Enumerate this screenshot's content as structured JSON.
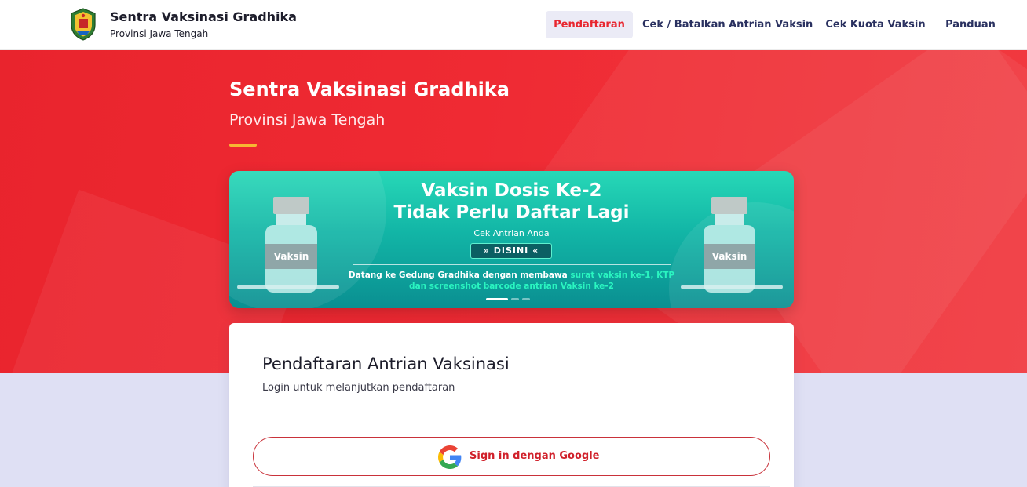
{
  "header": {
    "brand_title": "Sentra Vaksinasi Gradhika",
    "brand_subtitle": "Provinsi Jawa Tengah",
    "logo_icon": "province-crest-icon",
    "nav": [
      {
        "label": "Pendaftaran",
        "active": true
      },
      {
        "label": "Cek / Batalkan Antrian Vaksin",
        "active": false
      },
      {
        "label": "Cek Kuota Vaksin",
        "active": false
      },
      {
        "label": "Panduan",
        "active": false
      }
    ]
  },
  "hero": {
    "title": "Sentra Vaksinasi Gradhika",
    "subtitle": "Provinsi Jawa Tengah"
  },
  "banner": {
    "title_line1": "Vaksin Dosis Ke-2",
    "title_line2": "Tidak Perlu Daftar Lagi",
    "small_text": "Cek Antrian Anda",
    "button_label": "DISINI",
    "vial_label": "Vaksin",
    "info_line1_plain": "Datang ke Gedung Gradhika dengan membawa ",
    "info_line1_highlight": "surat vaksin ke-1, KTP",
    "info_line2_highlight": "dan screenshot barcode antrian Vaksin ke-2",
    "slide_count": 3,
    "active_slide": 1
  },
  "card": {
    "title": "Pendaftaran Antrian Vaksinasi",
    "subtitle": "Login untuk melanjutkan pendaftaran",
    "google_button_label": "Sign in dengan Google",
    "google_icon": "google-g-icon"
  },
  "colors": {
    "brand_red": "#e9242d",
    "accent_yellow": "#f7b733",
    "banner_teal": "#12b5a6",
    "highlight_green": "#2af5c0",
    "nav_text": "#2a3160",
    "page_bg": "#dfe0f4"
  }
}
